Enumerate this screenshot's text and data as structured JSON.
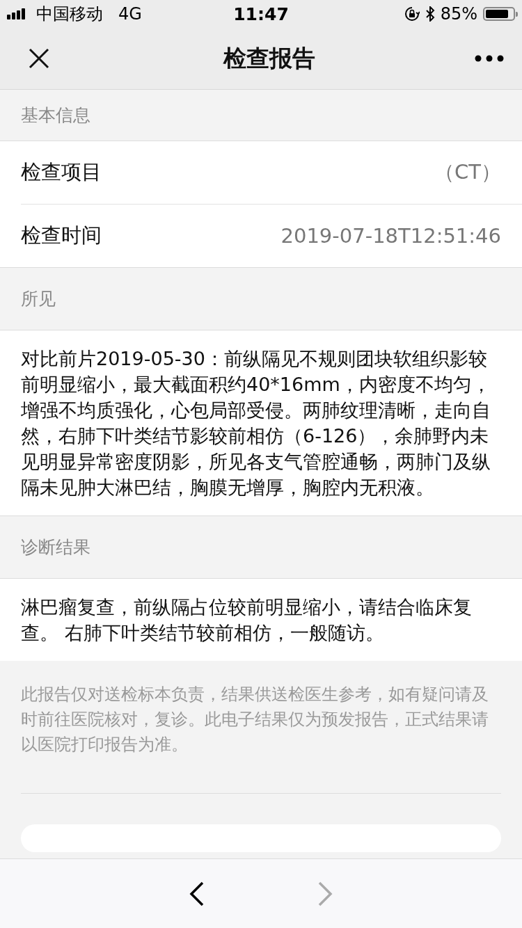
{
  "status_bar": {
    "carrier": "中国移动",
    "network": "4G",
    "time": "11:47",
    "battery": "85%"
  },
  "nav": {
    "title": "检查报告"
  },
  "basic": {
    "header": "基本信息",
    "rows": [
      {
        "label": "检查项目",
        "value": "（CT）"
      },
      {
        "label": "检查时间",
        "value": "2019-07-18T12:51:46"
      }
    ]
  },
  "findings": {
    "header": "所见",
    "text": "对比前片2019-05-30：前纵隔见不规则团块软组织影较前明显缩小，最大截面积约40*16mm，内密度不均匀，增强不均质强化，心包局部受侵。两肺纹理清晰，走向自然，右肺下叶类结节影较前相仿（6-126），余肺野内未见明显异常密度阴影，所见各支气管腔通畅，两肺门及纵隔未见肿大淋巴结，胸膜无增厚，胸腔内无积液。"
  },
  "diagnosis": {
    "header": "诊断结果",
    "text": "淋巴瘤复查，前纵隔占位较前明显缩小，请结合临床复查。 右肺下叶类结节较前相仿，一般随访。"
  },
  "notice": "此报告仅对送检标本负责，结果供送检医生参考，如有疑问请及时前往医院核对，复诊。此电子结果仅为预发报告，正式结果请以医院打印报告为准。",
  "toolbar": {
    "back_disabled": false,
    "forward_disabled": true
  }
}
